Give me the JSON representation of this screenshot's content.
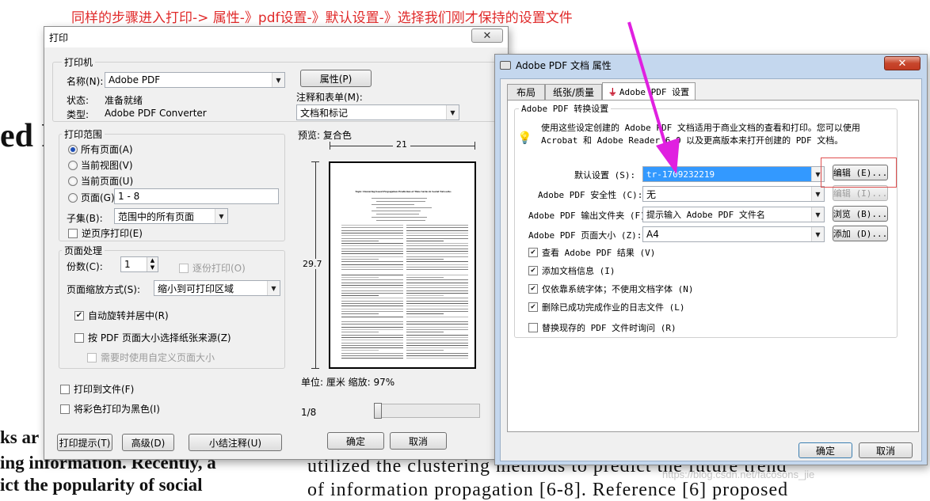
{
  "annotation": {
    "text": "同样的步骤进入打印-> 属性-》pdf设置-》默认设置-》选择我们刚才保持的设置文件",
    "color": "#e02a2a",
    "arrow_color": "#e020e0"
  },
  "background_doc": {
    "heading_fragment": "ed F",
    "left_lines": [
      "ks ar",
      "ing information. Recently, a",
      "ict the popularity of social"
    ],
    "right_lines": [
      "utilized the clustering methods to predict the future trend",
      "of information propagation [6-8]. Reference [6] proposed"
    ],
    "watermark": "https://blog.csdn.net/facosons_jie"
  },
  "print_dialog": {
    "title": "打印",
    "printer": {
      "group_label": "打印机",
      "name_label": "名称(N):",
      "name_value": "Adobe PDF",
      "status_label": "状态:",
      "status_value": "准备就绪",
      "type_label": "类型:",
      "type_value": "Adobe PDF Converter",
      "properties_button": "属性(P)",
      "annotations_label": "注释和表单(M):",
      "annotations_value": "文档和标记"
    },
    "range": {
      "group_label": "打印范围",
      "all_pages": "所有页面(A)",
      "current_view": "当前视图(V)",
      "current_page": "当前页面(U)",
      "pages": "页面(G)",
      "pages_value": "1 - 8",
      "subset_label": "子集(B):",
      "subset_value": "范围中的所有页面",
      "reverse": "逆页序打印(E)"
    },
    "handling": {
      "group_label": "页面处理",
      "copies_label": "份数(C):",
      "copies_value": "1",
      "collate": "逐份打印(O)",
      "scaling_label": "页面缩放方式(S):",
      "scaling_value": "缩小到可打印区域",
      "auto_rotate": "自动旋转并居中(R)",
      "choose_source": "按 PDF 页面大小选择纸张来源(Z)",
      "custom_size": "需要时使用自定义页面大小"
    },
    "print_to_file": "打印到文件(F)",
    "grayscale": "将彩色打印为黑色(I)",
    "preview": {
      "label": "预览: 复合色",
      "width": "21",
      "height": "29.7",
      "units": "单位: 厘米 缩放: 97%",
      "page_indicator": "1/8",
      "doc_title": "Topic Clustering based Propagation Prediction of Time Series in Social Networks"
    },
    "buttons": {
      "tips": "打印提示(T)",
      "advanced": "高级(D)",
      "summarize": "小结注释(U)",
      "ok": "确定",
      "cancel": "取消"
    }
  },
  "adobe_dialog": {
    "title": "Adobe PDF 文档 属性",
    "tabs": [
      "布局",
      "纸张/质量",
      "Adobe PDF 设置"
    ],
    "group_label": "Adobe PDF 转换设置",
    "info_line1": "使用这些设定创建的 Adobe PDF 文档适用于商业文档的查看和打印。您可以使用",
    "info_line2": "Acrobat 和 Adobe Reader 6.0 以及更高版本来打开创建的 PDF 文档。",
    "default_settings_label": "默认设置 (S):",
    "default_settings_value": "tr-1709232219",
    "edit_button": "编辑 (E)...",
    "security_label": "Adobe PDF 安全性 (C):",
    "security_value": "无",
    "security_edit_button": "编辑 (I)...",
    "output_folder_label": "Adobe PDF 输出文件夹 (F)",
    "output_folder_value": "提示输入 Adobe PDF 文件名",
    "browse_button": "浏览 (B)...",
    "page_size_label": "Adobe PDF 页面大小 (Z):",
    "page_size_value": "A4",
    "add_button": "添加 (D)...",
    "checks": [
      {
        "label": "查看 Adobe PDF 结果 (V)",
        "checked": true
      },
      {
        "label": "添加文档信息 (I)",
        "checked": true
      },
      {
        "label": "仅依靠系统字体；不使用文档字体 (N)",
        "checked": true
      },
      {
        "label": "删除已成功完成作业的日志文件 (L)",
        "checked": true
      },
      {
        "label": "替换现存的 PDF 文件时询问 (R)",
        "checked": false
      }
    ],
    "ok_button": "确定",
    "cancel_button": "取消",
    "highlight_color": "#3399ff",
    "callout_border_color": "#e05050"
  }
}
